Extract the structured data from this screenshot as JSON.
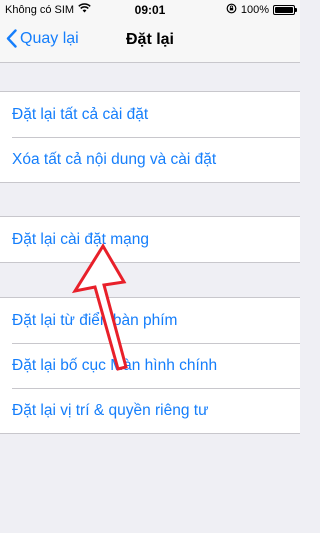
{
  "status_bar": {
    "carrier": "Không có SIM",
    "time": "09:01",
    "battery": "100%",
    "icons": [
      "wifi-icon",
      "rotation-lock-icon",
      "battery-icon"
    ]
  },
  "nav": {
    "back_label": "Quay lại",
    "title": "Đặt lại"
  },
  "groups": [
    {
      "items": [
        "Đặt lại tất cả cài đặt",
        "Xóa tất cả nội dung và cài đặt"
      ]
    },
    {
      "items": [
        "Đặt lại cài đặt mạng"
      ]
    },
    {
      "items": [
        "Đặt lại từ điển bàn phím",
        "Đặt lại bố cục Màn hình chính",
        "Đặt lại vị trí & quyền riêng tư"
      ]
    }
  ],
  "colors": {
    "accent": "#157efb",
    "background": "#efeff4",
    "annotation_arrow": "#e8202a"
  }
}
